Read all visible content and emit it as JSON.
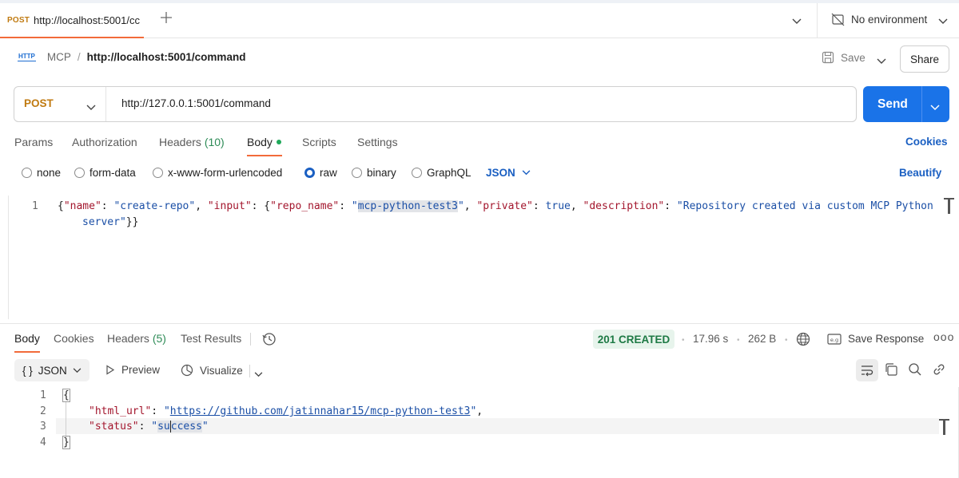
{
  "tab": {
    "method": "POST",
    "url": "http://localhost:5001/cc"
  },
  "environment": {
    "label": "No environment"
  },
  "breadcrumb": {
    "collection": "MCP",
    "separator": "/",
    "current": "http://localhost:5001/command"
  },
  "actions": {
    "save": "Save",
    "share": "Share"
  },
  "request": {
    "method": "POST",
    "url": "http://127.0.0.1:5001/command",
    "send": "Send"
  },
  "request_tabs": {
    "params": "Params",
    "authorization": "Authorization",
    "headers": "Headers",
    "headers_count": "(10)",
    "body": "Body",
    "scripts": "Scripts",
    "settings": "Settings",
    "cookies": "Cookies"
  },
  "body_types": {
    "none": "none",
    "form_data": "form-data",
    "urlencoded": "x-www-form-urlencoded",
    "raw": "raw",
    "binary": "binary",
    "graphql": "GraphQL",
    "json": "JSON",
    "beautify": "Beautify"
  },
  "request_body": {
    "line1": "1",
    "t1": "{",
    "k_name": "\"name\"",
    "v_name": "\"create-repo\"",
    "k_input": "\"input\"",
    "k_repo": "\"repo_name\"",
    "v_repo_q1": "\"",
    "v_repo": "mcp-python-test3",
    "v_repo_q2": "\"",
    "k_private": "\"private\"",
    "v_private": "true",
    "k_desc": "\"description\"",
    "v_desc1": "\"Repository created via custom MCP Python",
    "v_desc2": "server\"",
    "t_end": "}}"
  },
  "response_tabs": {
    "body": "Body",
    "cookies": "Cookies",
    "headers": "Headers",
    "headers_count": "(5)",
    "test_results": "Test Results"
  },
  "response_meta": {
    "status": "201 CREATED",
    "time": "17.96 s",
    "size": "262 B",
    "save_response": "Save Response",
    "more": "ooo"
  },
  "response_view": {
    "json": "JSON",
    "json_braces": "{ }",
    "preview": "Preview",
    "visualize": "Visualize"
  },
  "response_body": {
    "lines": [
      "1",
      "2",
      "3",
      "4"
    ],
    "open": "{",
    "k_url": "\"html_url\"",
    "v_url_q1": "\"",
    "v_url": "https://github.com/jatinnahar15/mcp-python-test3",
    "v_url_q2": "\"",
    "k_status": "\"status\"",
    "v_status_q1": "\"",
    "v_status_a": "su",
    "v_status_b": "ccess",
    "v_status_q2": "\"",
    "close": "}"
  },
  "colors": {
    "accent_orange": "#f26b3a",
    "send_blue": "#1a73e8",
    "method_post": "#c07a10",
    "status_green": "#1e7a45",
    "link_blue": "#1a5fc2"
  }
}
